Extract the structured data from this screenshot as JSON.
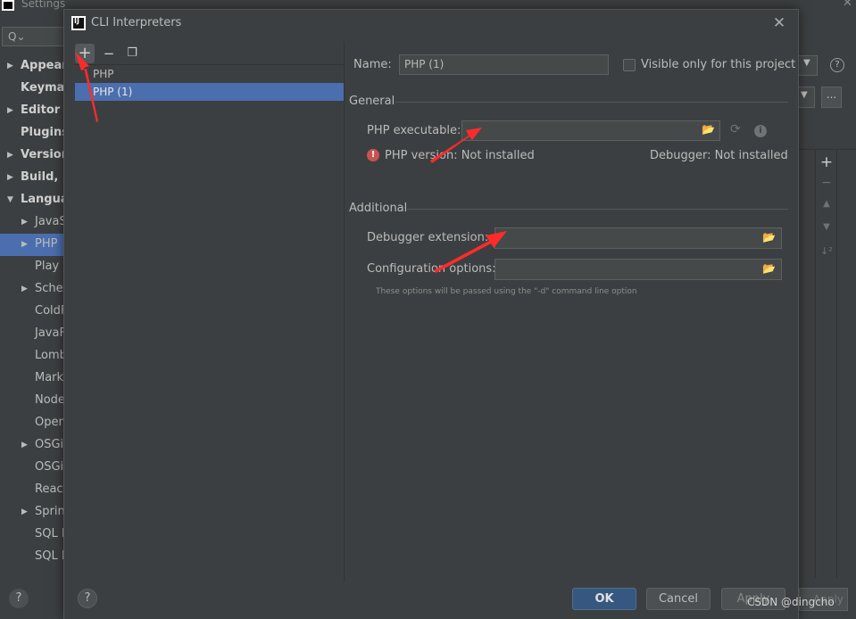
{
  "background": {
    "title": "Settings",
    "tree": [
      {
        "label": "Appeara",
        "level": "top",
        "arrow": "▶"
      },
      {
        "label": "Keymap",
        "level": "top",
        "arrow": ""
      },
      {
        "label": "Editor",
        "level": "top",
        "arrow": "▶"
      },
      {
        "label": "Plugins",
        "level": "top",
        "arrow": ""
      },
      {
        "label": "Version",
        "level": "top",
        "arrow": "▶"
      },
      {
        "label": "Build, E",
        "level": "top",
        "arrow": "▶"
      },
      {
        "label": "Languag",
        "level": "top",
        "arrow": "▼"
      },
      {
        "label": "JavaS",
        "level": "child",
        "arrow": "▶"
      },
      {
        "label": "PHP",
        "level": "child",
        "arrow": "▶",
        "selected": true
      },
      {
        "label": "Play C",
        "level": "child",
        "arrow": ""
      },
      {
        "label": "Scher",
        "level": "child",
        "arrow": "▶"
      },
      {
        "label": "ColdF",
        "level": "child",
        "arrow": ""
      },
      {
        "label": "JavaF",
        "level": "child",
        "arrow": ""
      },
      {
        "label": "Lomb",
        "level": "child",
        "arrow": ""
      },
      {
        "label": "Mark",
        "level": "child",
        "arrow": ""
      },
      {
        "label": "Node",
        "level": "child",
        "arrow": ""
      },
      {
        "label": "Open",
        "level": "child",
        "arrow": ""
      },
      {
        "label": "OSGi",
        "level": "child",
        "arrow": "▶"
      },
      {
        "label": "OSGi",
        "level": "child",
        "arrow": ""
      },
      {
        "label": "React",
        "level": "child",
        "arrow": ""
      },
      {
        "label": "Sprin",
        "level": "child",
        "arrow": "▶"
      },
      {
        "label": "SQL D",
        "level": "child",
        "arrow": ""
      },
      {
        "label": "SQL F",
        "level": "child",
        "arrow": ""
      }
    ],
    "more_button": "...",
    "apply_label": "Apply"
  },
  "dialog": {
    "title": "CLI Interpreters",
    "toolbar": {
      "add": "+",
      "remove": "−",
      "copy": "❐"
    },
    "interpreters": [
      {
        "label": "PHP",
        "selected": false
      },
      {
        "label": "PHP (1)",
        "selected": true
      }
    ],
    "name_label": "Name:",
    "name_value": "PHP (1)",
    "visible_only_label": "Visible only for this project",
    "general_title": "General",
    "php_executable_label": "PHP executable:",
    "php_version_text": "PHP version: Not installed",
    "debugger_text": "Debugger: Not installed",
    "additional_title": "Additional",
    "debugger_extension_label": "Debugger extension:",
    "configuration_options_label": "Configuration options:",
    "config_hint": "These options will be passed using the \"-d\" command line option",
    "buttons": {
      "ok": "OK",
      "cancel": "Cancel",
      "apply": "Apply"
    }
  },
  "watermark": "CSDN @dingcho",
  "colors": {
    "accent": "#4b6eaf",
    "ok_button": "#365880",
    "error": "#c75450",
    "annotation_arrow": "#ff2b2b"
  }
}
